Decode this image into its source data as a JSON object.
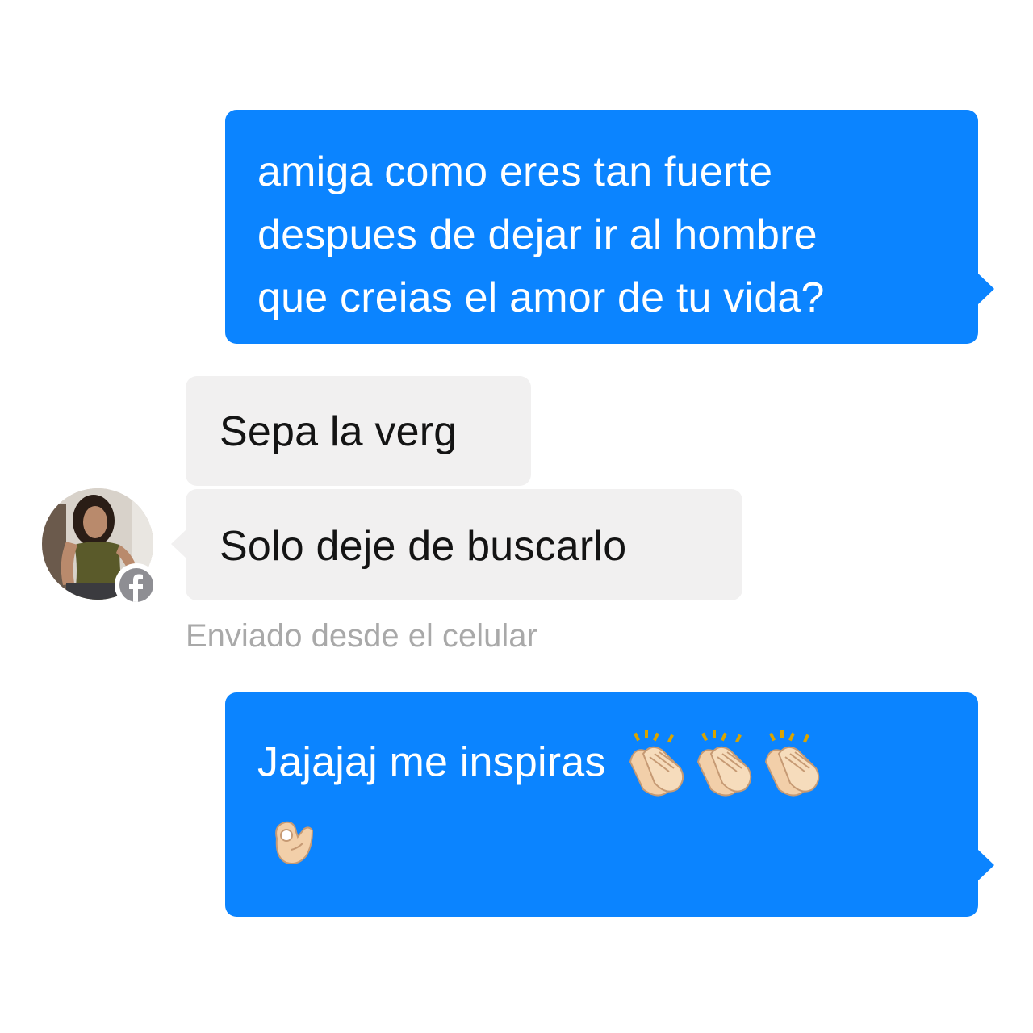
{
  "messages": [
    {
      "direction": "outgoing",
      "lines": [
        "amiga como eres tan fuerte",
        "despues de dejar ir al hombre",
        "que creias el amor de tu vida?"
      ]
    },
    {
      "direction": "incoming",
      "text": "Sepa la verg"
    },
    {
      "direction": "incoming",
      "text": "Solo deje de buscarlo"
    },
    {
      "direction": "outgoing",
      "text": "Jajajaj me inspiras",
      "emojis": [
        "clapping-hands",
        "clapping-hands",
        "clapping-hands",
        "ok-hand"
      ]
    }
  ],
  "status": "Enviado desde el celular",
  "sender": {
    "avatar_icon": "contact-photo",
    "badge_icon": "facebook-icon"
  },
  "colors": {
    "outgoing_bubble": "#0b84ff",
    "incoming_bubble": "#f1f0f0",
    "status_text": "#a9a9a9"
  }
}
